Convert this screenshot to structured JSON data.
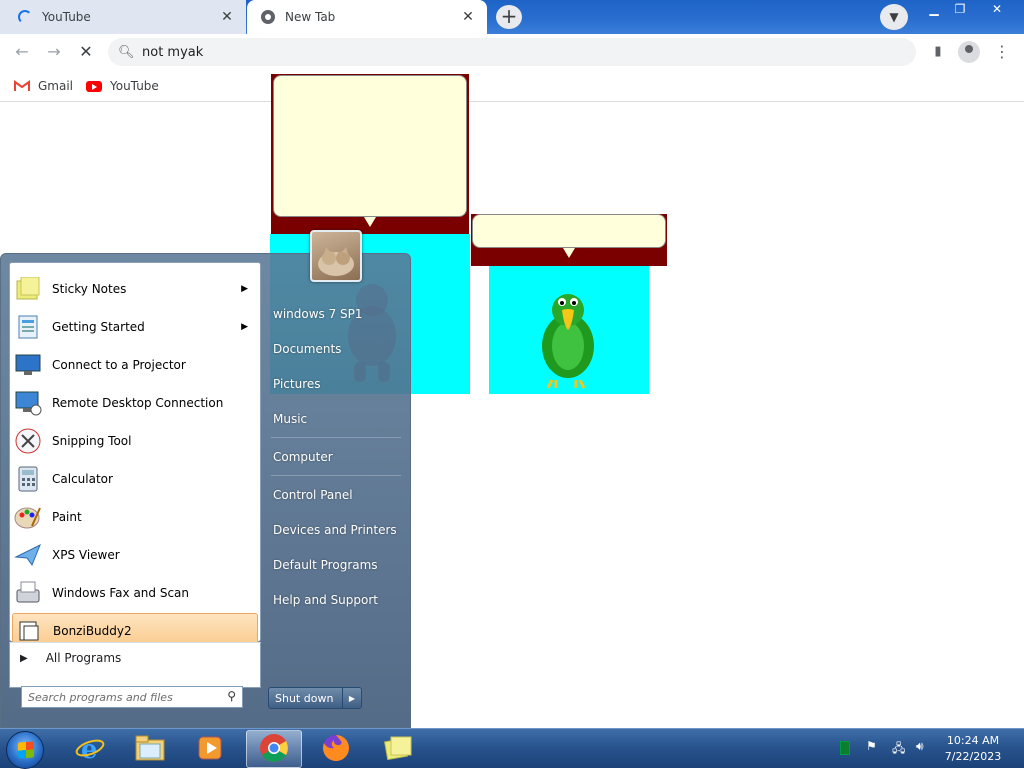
{
  "browser": {
    "tabs": [
      {
        "title": "YouTube",
        "state": "loading"
      },
      {
        "title": "New Tab",
        "state": "active"
      }
    ],
    "omnibox": {
      "text": "not myak"
    },
    "bookmarks": [
      {
        "label": "Gmail",
        "icon": "gmail-icon"
      },
      {
        "label": "YouTube",
        "icon": "youtube-icon"
      }
    ],
    "colors": {
      "tabstrip": "#1e63c6",
      "omnibox_bg": "#f1f3f4"
    }
  },
  "page": {
    "agents": [
      {
        "name": "gorilla",
        "bubble_color": "#ffffdc",
        "background": "#00ffff"
      },
      {
        "name": "parrot",
        "bubble_color": "#ffffdc",
        "background": "#00ffff"
      }
    ]
  },
  "start_menu": {
    "programs": [
      {
        "label": "Sticky Notes",
        "icon": "sticky-notes-icon",
        "has_submenu": true
      },
      {
        "label": "Getting Started",
        "icon": "getting-started-icon",
        "has_submenu": true
      },
      {
        "label": "Connect to a Projector",
        "icon": "projector-icon",
        "has_submenu": false
      },
      {
        "label": "Remote Desktop Connection",
        "icon": "remote-desktop-icon",
        "has_submenu": false
      },
      {
        "label": "Snipping Tool",
        "icon": "scissors-icon",
        "has_submenu": false
      },
      {
        "label": "Calculator",
        "icon": "calculator-icon",
        "has_submenu": false
      },
      {
        "label": "Paint",
        "icon": "paint-palette-icon",
        "has_submenu": false
      },
      {
        "label": "XPS Viewer",
        "icon": "xps-viewer-icon",
        "has_submenu": false
      },
      {
        "label": "Windows Fax and Scan",
        "icon": "fax-icon",
        "has_submenu": false
      },
      {
        "label": "BonziBuddy2",
        "icon": "bonzibuddy-icon",
        "has_submenu": false,
        "highlighted": true
      }
    ],
    "all_programs": "All Programs",
    "search_placeholder": "Search programs and files",
    "right": {
      "user": "windows 7 SP1",
      "documents": "Documents",
      "pictures": "Pictures",
      "music": "Music",
      "computer": "Computer",
      "control_panel": "Control Panel",
      "devices": "Devices and Printers",
      "defaults": "Default Programs",
      "help": "Help and Support"
    },
    "shutdown": "Shut down"
  },
  "taskbar": {
    "apps": [
      {
        "name": "internet-explorer-icon"
      },
      {
        "name": "file-explorer-icon"
      },
      {
        "name": "media-player-icon"
      },
      {
        "name": "chrome-icon",
        "active": true
      },
      {
        "name": "firefox-icon"
      },
      {
        "name": "sticky-notes-taskbar-icon"
      }
    ],
    "clock": {
      "time": "10:24 AM",
      "date": "7/22/2023"
    }
  }
}
